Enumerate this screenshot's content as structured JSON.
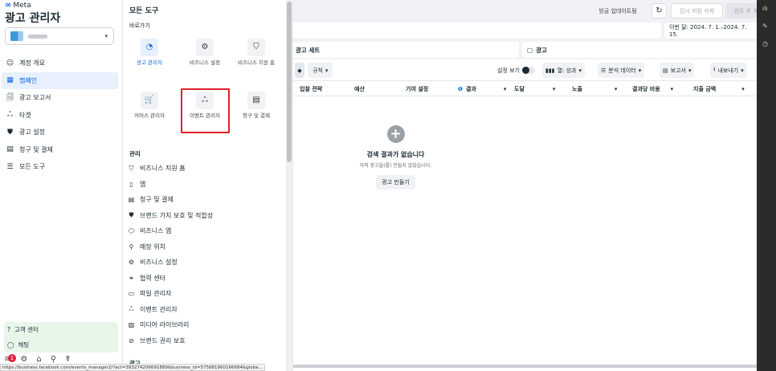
{
  "brand": {
    "logo_text": "Meta",
    "app_title": "광고 관리자"
  },
  "account": {
    "chevron": "▾"
  },
  "leftnav": {
    "items": [
      {
        "label": "계정 개요",
        "icon": "☺"
      },
      {
        "label": "캠페인",
        "icon": "▦"
      },
      {
        "label": "광고 보고서",
        "icon": "🗐"
      },
      {
        "label": "타겟",
        "icon": "ஃ"
      },
      {
        "label": "광고 설정",
        "icon": "⛊"
      },
      {
        "label": "청구 및 결제",
        "icon": "▤"
      },
      {
        "label": "모든 도구",
        "icon": "☰"
      }
    ],
    "help": [
      {
        "label": "고객 센터",
        "icon": "?"
      },
      {
        "label": "채팅",
        "icon": "◯"
      }
    ],
    "notification_count": "1"
  },
  "tools": {
    "title": "모든 도구",
    "shortcuts_label": "바로가기",
    "tiles": [
      {
        "label": "광고 관리자",
        "icon": "◔"
      },
      {
        "label": "비즈니스 설정",
        "icon": "⚙"
      },
      {
        "label": "비즈니스 지원 홈",
        "icon": "⛉"
      },
      {
        "label": "커머스 관리자",
        "icon": "🛒"
      },
      {
        "label": "이벤트 관리자",
        "icon": "ஃ"
      },
      {
        "label": "청구 및 결제",
        "icon": "▤"
      }
    ],
    "manage_label": "관리",
    "items": [
      {
        "label": "비즈니스 지원 홈",
        "icon": "⛉"
      },
      {
        "label": "앱",
        "icon": "▯"
      },
      {
        "label": "청구 및 결제",
        "icon": "▤"
      },
      {
        "label": "브랜드 가치 보호 및 적합성",
        "icon": "⛊"
      },
      {
        "label": "비즈니스 앱",
        "icon": "⬡"
      },
      {
        "label": "매장 위치",
        "icon": "⚲"
      },
      {
        "label": "비즈니스 설정",
        "icon": "⚙"
      },
      {
        "label": "협력 센터",
        "icon": "⚭"
      },
      {
        "label": "파일 관리자",
        "icon": "▭"
      },
      {
        "label": "이벤트 관리자",
        "icon": "ஃ"
      },
      {
        "label": "미디어 라이브러리",
        "icon": "▨"
      },
      {
        "label": "브랜드 권리 보호",
        "icon": "⊘"
      }
    ],
    "ads_label": "광고"
  },
  "topbar": {
    "update_label": "방금 업데이트됨",
    "refresh_icon": "↻",
    "discard_label": "임시 저장 삭제",
    "review_label": "검토 후 게시"
  },
  "date_range": "이번 달: 2024. 7. 1.–2024. 7. 15.",
  "tabs": {
    "adset": "광고 세트",
    "ads": "광고"
  },
  "toolbar": {
    "rules": "규칙",
    "setting_view": "설정 보기",
    "columns": "열: 성과",
    "breakdown": "분석 데이터",
    "reports": "보고서",
    "export": "내보내기"
  },
  "columns": [
    "입찰 전략",
    "예산",
    "기여 설정",
    "결과",
    "도달",
    "노출",
    "결과당 비용",
    "지출 금액"
  ],
  "empty_state": {
    "title": "검색 결과가 없습니다",
    "subtitle": "아직 광고을(를) 만들지 않았습니다.",
    "button": "광고 만들기"
  },
  "status_url": "https://business.facebook.com/events_manager2/?act=393274206691889&business_id=575881960166684&globa..."
}
